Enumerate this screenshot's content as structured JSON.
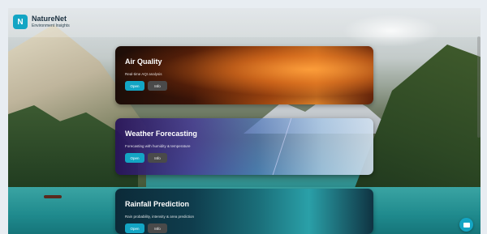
{
  "header": {
    "logo_letter": "N",
    "app_title": "NatureNet",
    "app_subtitle": "Environment Insights"
  },
  "cards": [
    {
      "title": "Air Quality",
      "description": "Real-time AQI analysis",
      "open_label": "Open",
      "info_label": "Info"
    },
    {
      "title": "Weather Forecasting",
      "description": "Forecasting with humidity & temperature",
      "open_label": "Open",
      "info_label": "Info"
    },
    {
      "title": "Rainfall Prediction",
      "description": "Rain probability, intensity & area prediction",
      "open_label": "Open",
      "info_label": "Info"
    }
  ],
  "colors": {
    "accent": "#13a5c4"
  },
  "icons": {
    "chat": "chat-icon"
  }
}
